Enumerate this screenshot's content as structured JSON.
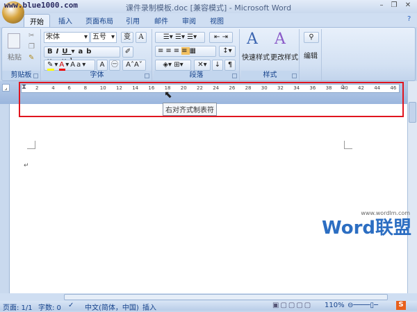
{
  "titlebar": {
    "site": "www.blue1000.com",
    "title": "课件录制模板.doc [兼容模式] - Microsoft Word"
  },
  "tabs": [
    "开始",
    "插入",
    "页面布局",
    "引用",
    "邮件",
    "审阅",
    "视图"
  ],
  "ribbon": {
    "clipboard": {
      "label": "剪贴板",
      "paste": "粘贴"
    },
    "font": {
      "label": "字体",
      "font_name": "宋体",
      "font_size": "五号"
    },
    "paragraph": {
      "label": "段落"
    },
    "styles": {
      "label": "样式",
      "quick": "快速样式",
      "change": "更改样式"
    },
    "editing": {
      "label": "编辑"
    }
  },
  "ruler": {
    "labels": [
      "2",
      "4",
      "6",
      "8",
      "10",
      "12",
      "14",
      "16",
      "18",
      "20",
      "22",
      "24",
      "26",
      "28",
      "30",
      "32",
      "34",
      "36",
      "38",
      "40",
      "42",
      "44",
      "46"
    ]
  },
  "tooltip": "右对齐式制表符",
  "document": {
    "paragraph_mark": "↵"
  },
  "watermark": {
    "url": "www.wordlm.com",
    "brand": "Word联盟"
  },
  "statusbar": {
    "page": "页面: 1/1",
    "words": "字数: 0",
    "language": "中文(简体，中国)",
    "mode": "插入",
    "zoom": "110%"
  },
  "colors": {
    "highlight_box": "#e0141e",
    "ribbon_bg": "#d3e1f3"
  }
}
